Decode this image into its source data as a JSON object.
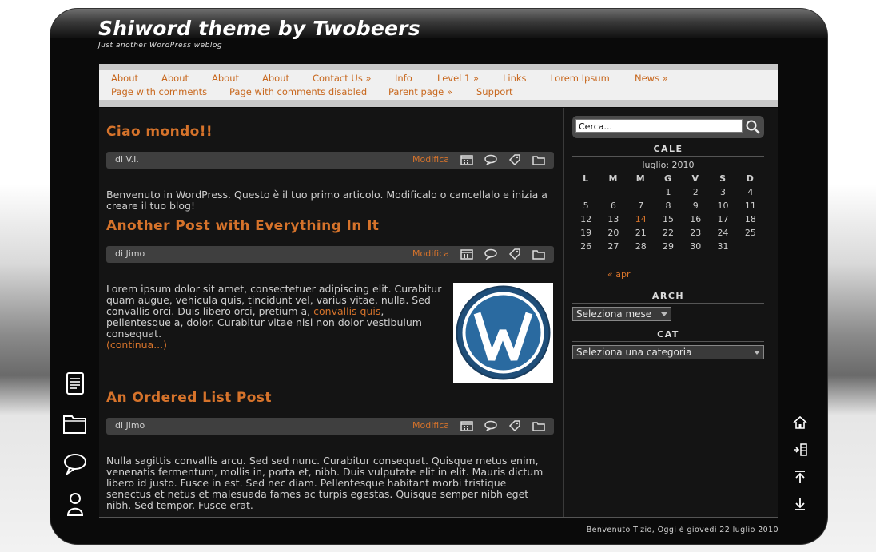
{
  "site": {
    "title": "Shiword theme by Twobeers",
    "tagline": "Just another WordPress weblog"
  },
  "menu": {
    "row1": [
      "About",
      "About",
      "About",
      "About",
      "Contact Us »",
      "Info",
      "Level 1 »",
      "Links",
      "Lorem Ipsum",
      "News »"
    ],
    "row2": [
      "Page with comments",
      "Page with comments disabled",
      "Parent page »",
      "Support"
    ]
  },
  "posts": [
    {
      "title": "Ciao mondo!!",
      "author": "di V.I.",
      "edit": "Modifica",
      "text": "Benvenuto in WordPress. Questo è il tuo primo articolo. Modificalo o cancellalo e inizia a creare il tuo blog!"
    },
    {
      "title": "Another Post with Everything In It",
      "author": "di Jimo",
      "edit": "Modifica",
      "text_before": "Lorem ipsum dolor sit amet, consectetuer adipiscing elit. Curabitur quam augue, vehicula quis, tincidunt vel, varius vitae, nulla. Sed convallis orci. Duis libero orci, pretium a, ",
      "link": "convallis quis",
      "text_after": ", pellentesque a, dolor. Curabitur vitae nisi non dolor vestibulum consequat.",
      "more": "(continua...)"
    },
    {
      "title": "An Ordered List Post",
      "author": "di Jimo",
      "edit": "Modifica",
      "text": "Nulla sagittis convallis arcu. Sed sed nunc. Curabitur consequat. Quisque metus enim, venenatis fermentum, mollis in, porta et, nibh. Duis vulputate elit in elit. Mauris dictum libero id justo. Fusce in est. Sed nec diam. Pellentesque habitant morbi tristique senectus et netus et malesuada fames ac turpis egestas. Quisque semper nibh eget nibh. Sed tempor. Fusce erat."
    }
  ],
  "sidebar": {
    "search_value": "Cerca...",
    "calendar": {
      "title": "CALE",
      "caption": "luglio: 2010",
      "weekdays": [
        "L",
        "M",
        "M",
        "G",
        "V",
        "S",
        "D"
      ],
      "weeks": [
        [
          "",
          "",
          "",
          "1",
          "2",
          "3",
          "4"
        ],
        [
          "5",
          "6",
          "7",
          "8",
          "9",
          "10",
          "11"
        ],
        [
          "12",
          "13",
          "14",
          "15",
          "16",
          "17",
          "18"
        ],
        [
          "19",
          "20",
          "21",
          "22",
          "23",
          "24",
          "25"
        ],
        [
          "26",
          "27",
          "28",
          "29",
          "30",
          "31",
          ""
        ]
      ],
      "today": "14",
      "prev": "« apr"
    },
    "archive": {
      "title": "ARCH",
      "select": "Seleziona mese"
    },
    "categories": {
      "title": "CAT",
      "select": "Seleziona una categoria"
    }
  },
  "footer": "Benvenuto Tizio, Oggi è giovedì 22 luglio 2010",
  "icons": {
    "left_dock": [
      "document-icon",
      "folder-icon",
      "comment-icon",
      "user-icon"
    ],
    "right_dock": [
      "home-icon",
      "share-icon",
      "top-icon",
      "bottom-icon"
    ],
    "meta": [
      "calendar-icon",
      "comment-icon",
      "tag-icon",
      "folder-icon"
    ]
  },
  "colors": {
    "accent": "#d6732b",
    "background": "#141414",
    "menu": "#f0f0f0"
  }
}
